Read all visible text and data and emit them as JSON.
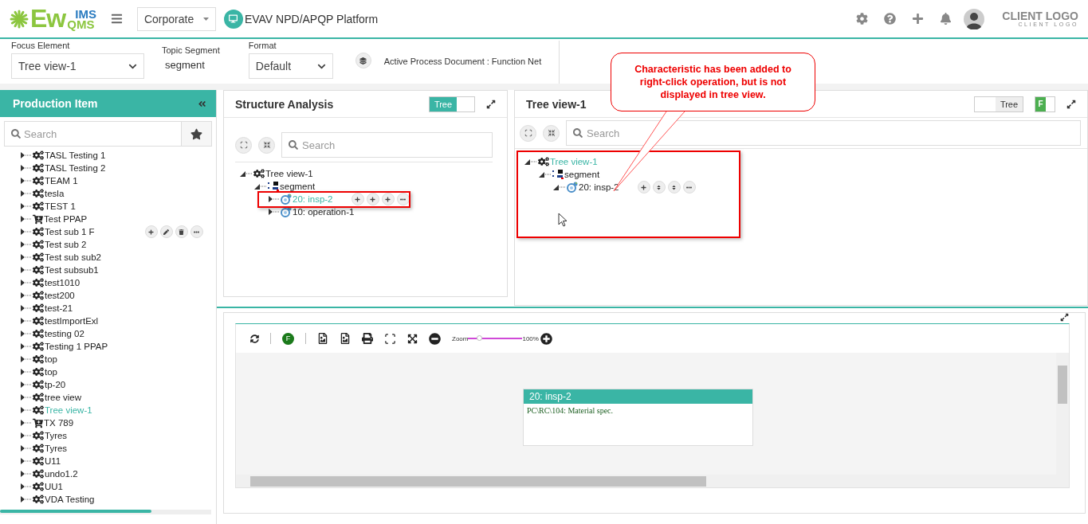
{
  "header": {
    "logo": {
      "main": "Ew",
      "top": "IMS",
      "bottom": "QMS"
    },
    "company": "Corporate",
    "platform": "EVAV NPD/APQP Platform",
    "client_logo": {
      "title": "CLIENT LOGO",
      "subtitle": "CLIENT LOGO"
    }
  },
  "filters": {
    "focus_element": {
      "label": "Focus Element",
      "value": "Tree view-1"
    },
    "topic_segment": {
      "label": "Topic Segment",
      "value": "segment"
    },
    "format": {
      "label": "Format",
      "value": "Default"
    },
    "active_document": "Active Process Document : Function Net"
  },
  "sidebar": {
    "title": "Production Item",
    "search": {
      "placeholder": "Search"
    },
    "items": [
      {
        "label": "TASL Testing 1",
        "kind": "gear",
        "expanded": false,
        "selected": false
      },
      {
        "label": "TASL Testing 2",
        "kind": "gear",
        "expanded": false,
        "selected": false
      },
      {
        "label": "TEAM 1",
        "kind": "gear",
        "expanded": false,
        "selected": false
      },
      {
        "label": "tesla",
        "kind": "gear",
        "expanded": false,
        "selected": false
      },
      {
        "label": "TEST 1",
        "kind": "gear",
        "expanded": false,
        "selected": false
      },
      {
        "label": "Test PPAP",
        "kind": "cart",
        "expanded": false,
        "selected": false
      },
      {
        "label": "Test sub 1 F",
        "kind": "gear",
        "expanded": false,
        "selected": false,
        "hovered": true
      },
      {
        "label": "Test sub 2",
        "kind": "gear",
        "expanded": false,
        "selected": false
      },
      {
        "label": "Test sub sub2",
        "kind": "gear",
        "expanded": false,
        "selected": false
      },
      {
        "label": "Test subsub1",
        "kind": "gear",
        "expanded": false,
        "selected": false
      },
      {
        "label": "test1010",
        "kind": "gear",
        "expanded": false,
        "selected": false
      },
      {
        "label": "test200",
        "kind": "gear",
        "expanded": false,
        "selected": false
      },
      {
        "label": "test-21",
        "kind": "gear",
        "expanded": false,
        "selected": false
      },
      {
        "label": "testImportExl",
        "kind": "gear",
        "expanded": false,
        "selected": false
      },
      {
        "label": "testing 02",
        "kind": "gear",
        "expanded": false,
        "selected": false
      },
      {
        "label": "Testing 1 PPAP",
        "kind": "gear",
        "expanded": false,
        "selected": false
      },
      {
        "label": "top",
        "kind": "gear",
        "expanded": false,
        "selected": false
      },
      {
        "label": "top",
        "kind": "gear",
        "expanded": false,
        "selected": false
      },
      {
        "label": "tp-20",
        "kind": "gear",
        "expanded": false,
        "selected": false
      },
      {
        "label": "tree view",
        "kind": "gear",
        "expanded": false,
        "selected": false
      },
      {
        "label": "Tree view-1",
        "kind": "gear",
        "expanded": false,
        "selected": true
      },
      {
        "label": "TX 789",
        "kind": "cart",
        "expanded": false,
        "selected": false
      },
      {
        "label": "Tyres",
        "kind": "gear",
        "expanded": false,
        "selected": false
      },
      {
        "label": "Tyres",
        "kind": "gear",
        "expanded": false,
        "selected": false
      },
      {
        "label": "U11",
        "kind": "gear",
        "expanded": false,
        "selected": false
      },
      {
        "label": "undo1.2",
        "kind": "gear",
        "expanded": false,
        "selected": false
      },
      {
        "label": "UU1",
        "kind": "gear",
        "expanded": false,
        "selected": false
      },
      {
        "label": "VDA Testing",
        "kind": "gear",
        "expanded": false,
        "selected": false
      }
    ]
  },
  "structure_analysis": {
    "title": "Structure Analysis",
    "toggle": {
      "label": "Tree",
      "on": true
    },
    "search": {
      "placeholder": "Search"
    },
    "tree": [
      {
        "label": "Tree view-1",
        "kind": "gear",
        "expanded": true,
        "selected": false,
        "children": [
          {
            "label": "segment",
            "kind": "segment",
            "expanded": true,
            "selected": false,
            "children": [
              {
                "label": "20: insp-2",
                "kind": "operation",
                "expanded": false,
                "selected": true,
                "highlighted": true,
                "hovered": true
              },
              {
                "label": "10: operation-1",
                "kind": "operation",
                "expanded": false,
                "selected": false
              }
            ]
          }
        ]
      }
    ]
  },
  "tree_view": {
    "title": "Tree view-1",
    "toggle": {
      "label": "Tree",
      "on": false
    },
    "f_toggle": {
      "label": "F",
      "on": true
    },
    "search": {
      "placeholder": "Search"
    },
    "tree": [
      {
        "label": "Tree view-1",
        "kind": "gear",
        "expanded": true,
        "selected": true,
        "children": [
          {
            "label": "segment",
            "kind": "segment",
            "expanded": true,
            "selected": false,
            "children": [
              {
                "label": "20: insp-2",
                "kind": "operation",
                "expanded": true,
                "selected": false,
                "hovered": true
              }
            ]
          }
        ]
      }
    ]
  },
  "callout": "Characteristic has been added to right-click operation, but is not displayed in tree view.",
  "diagram": {
    "f_badge": "F",
    "zoom": {
      "label": "Zoom",
      "level": 0.2,
      "reading": "100%"
    },
    "node": {
      "title": "20: insp-2",
      "lines": [
        "PC\\RC\\104: Material spec."
      ]
    }
  }
}
